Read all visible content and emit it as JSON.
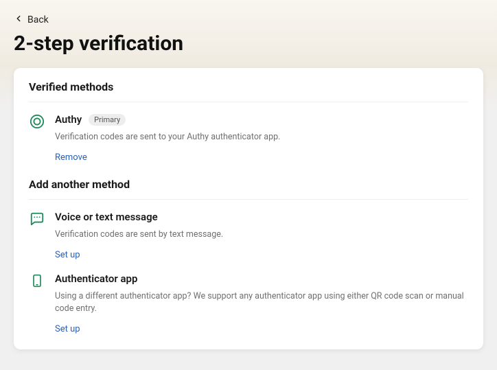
{
  "back_label": "Back",
  "page_title": "2-step verification",
  "sections": {
    "verified_header": "Verified methods",
    "add_header": "Add another method"
  },
  "verified": [
    {
      "title": "Authy",
      "badge": "Primary",
      "description": "Verification codes are sent to your Authy authenticator app.",
      "action": "Remove"
    }
  ],
  "add_methods": [
    {
      "title": "Voice or text message",
      "description": "Verification codes are sent by text message.",
      "action": "Set up"
    },
    {
      "title": "Authenticator app",
      "description": "Using a different authenticator app? We support any authenticator app using either QR code scan or manual code entry.",
      "action": "Set up"
    }
  ]
}
